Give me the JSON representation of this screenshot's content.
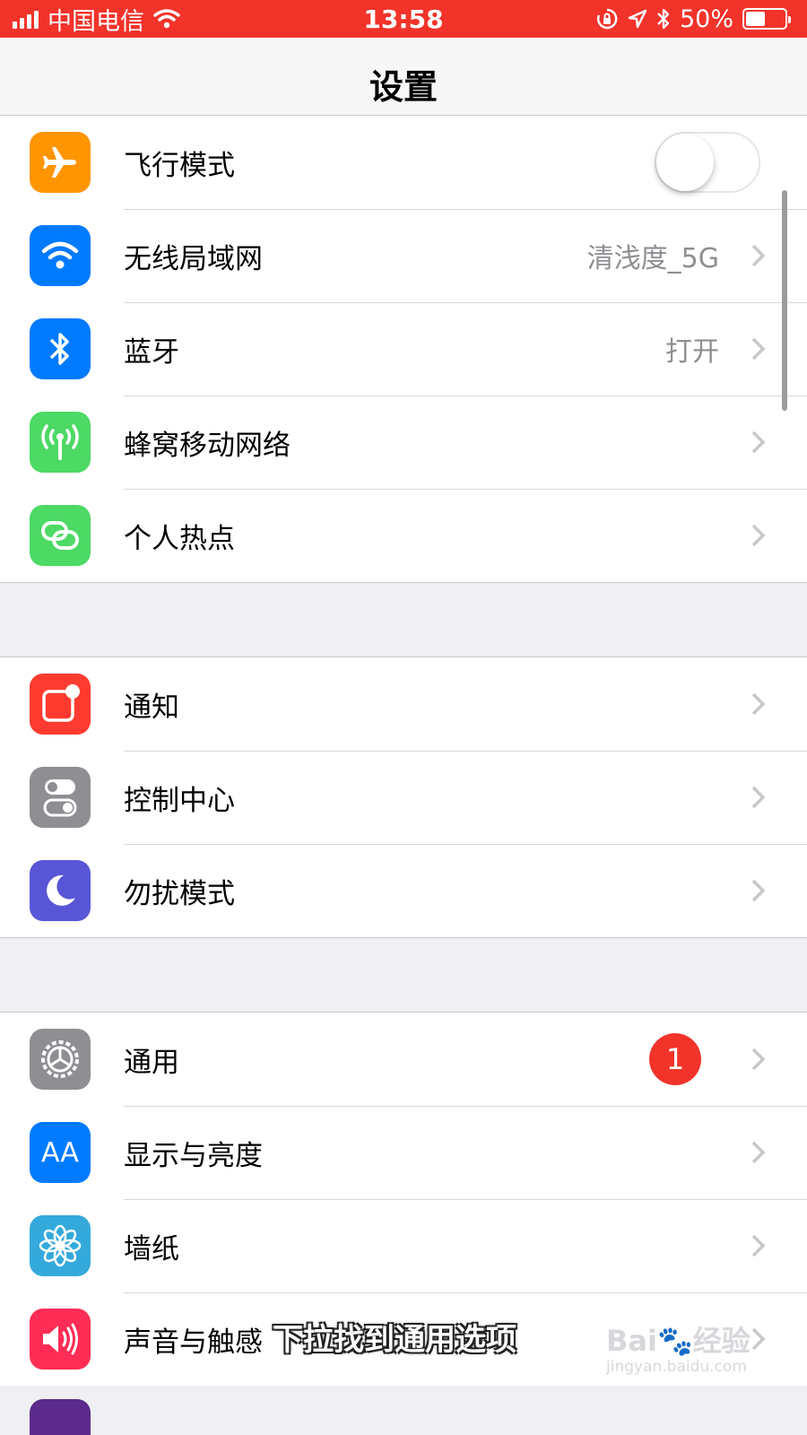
{
  "status_bar": {
    "carrier": "中国电信",
    "time": "13:58",
    "battery_percent_text": "50%",
    "battery_level": 0.5,
    "bg_color": "#f2332a"
  },
  "nav": {
    "title": "设置"
  },
  "group1": {
    "airplane": {
      "label": "飞行模式",
      "icon": "airplane-icon",
      "color": "#ff9500",
      "toggle_on": false
    },
    "wifi": {
      "label": "无线局域网",
      "value": "清浅度_5G",
      "icon": "wifi-icon",
      "color": "#007aff"
    },
    "bluetooth": {
      "label": "蓝牙",
      "value": "打开",
      "icon": "bluetooth-icon",
      "color": "#007aff"
    },
    "cellular": {
      "label": "蜂窝移动网络",
      "icon": "cellular-antenna-icon",
      "color": "#4cd964"
    },
    "hotspot": {
      "label": "个人热点",
      "icon": "hotspot-chain-icon",
      "color": "#4cd964"
    }
  },
  "group2": {
    "notifications": {
      "label": "通知",
      "icon": "notification-icon",
      "color": "#ff3b30"
    },
    "control_center": {
      "label": "控制中心",
      "icon": "toggles-icon",
      "color": "#8e8e93"
    },
    "dnd": {
      "label": "勿扰模式",
      "icon": "moon-icon",
      "color": "#5856d6"
    }
  },
  "group3": {
    "general": {
      "label": "通用",
      "badge": "1",
      "icon": "gear-icon",
      "color": "#8e8e93"
    },
    "display": {
      "label": "显示与亮度",
      "icon": "text-size-icon",
      "icon_text": "AA",
      "color": "#007aff"
    },
    "wallpaper": {
      "label": "墙纸",
      "icon": "flower-icon",
      "color": "#34aadc"
    },
    "sounds": {
      "label": "声音与触感",
      "icon": "speaker-icon",
      "color": "#ff2d55"
    }
  },
  "caption": "下拉找到通用选项",
  "watermark": {
    "brand": "Bai",
    "brand_suffix": "经验",
    "url": "jingyan.baidu.com"
  }
}
